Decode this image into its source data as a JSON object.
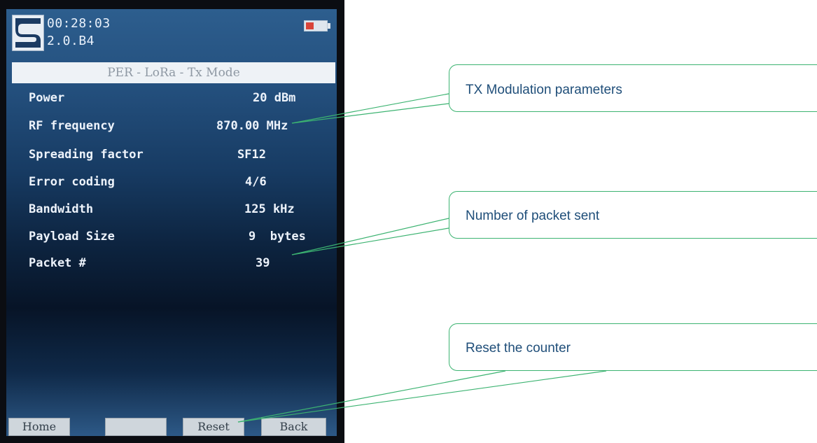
{
  "device": {
    "clock": "00:28:03",
    "version": "2.0.B4",
    "title": "PER - LoRa - Tx Mode",
    "parameters": [
      {
        "label": "Power",
        "value": "20 dBm"
      },
      {
        "label": "RF frequency",
        "value": "870.00 MHz"
      },
      {
        "label": "Spreading factor",
        "value": "SF12"
      },
      {
        "label": "Error coding",
        "value": "4/6"
      },
      {
        "label": "Bandwidth",
        "value": "125 kHz"
      },
      {
        "label": "Payload Size",
        "value": "9  bytes"
      },
      {
        "label": "Packet #",
        "value": "39"
      }
    ],
    "softkeys": [
      "Home",
      "",
      "Reset",
      "Back"
    ]
  },
  "callouts": {
    "modulation": "TX Modulation parameters",
    "packets": "Number of packet sent",
    "reset": "Reset the counter"
  },
  "colors": {
    "callout_border": "#3cb371",
    "callout_text": "#1f4e79",
    "battery_level": "#d8443a"
  }
}
